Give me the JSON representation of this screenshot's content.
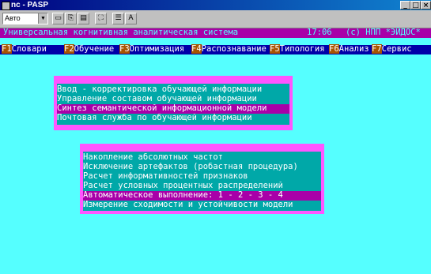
{
  "window": {
    "title": "nc - PASP",
    "min_glyph": "_",
    "max_glyph": "□",
    "close_glyph": "×"
  },
  "toolbar": {
    "font_select_value": "Авто",
    "tools": [
      "mark-icon",
      "copy-icon",
      "paste-icon",
      "fullscreen-icon",
      "properties-icon",
      "font-icon"
    ]
  },
  "statusline": {
    "system_name": "Универсальная когнитивная аналитическая система",
    "time": "17:06",
    "copyright": "(c) НПП *ЭЙДОС*"
  },
  "menu": [
    {
      "key": "F1",
      "label": "Словари"
    },
    {
      "key": "F2",
      "label": "Обучение"
    },
    {
      "key": "F3",
      "label": "Оптимизация"
    },
    {
      "key": "F4",
      "label": "Распознавание"
    },
    {
      "key": "F5",
      "label": "Типология"
    },
    {
      "key": "F6",
      "label": "Анализ"
    },
    {
      "key": "F7",
      "label": "Сервис"
    }
  ],
  "submenu1": [
    "Ввод - корректировка обучающей информации",
    "Управление составом обучающей информации",
    "Синтез семантической информационной модели",
    "Почтовая служба по обучающей информации"
  ],
  "submenu1_selected": 2,
  "submenu2": [
    "Накопление абсолютных частот",
    "Исключение артефактов (робастная процедура)",
    "Расчет информативностей признаков",
    "Расчет условных процентных распределений",
    "Автоматическое выполнение: 1 - 2 - 3 - 4",
    "Измерение сходимости и устойчивости модели"
  ],
  "submenu2_selected": 4
}
